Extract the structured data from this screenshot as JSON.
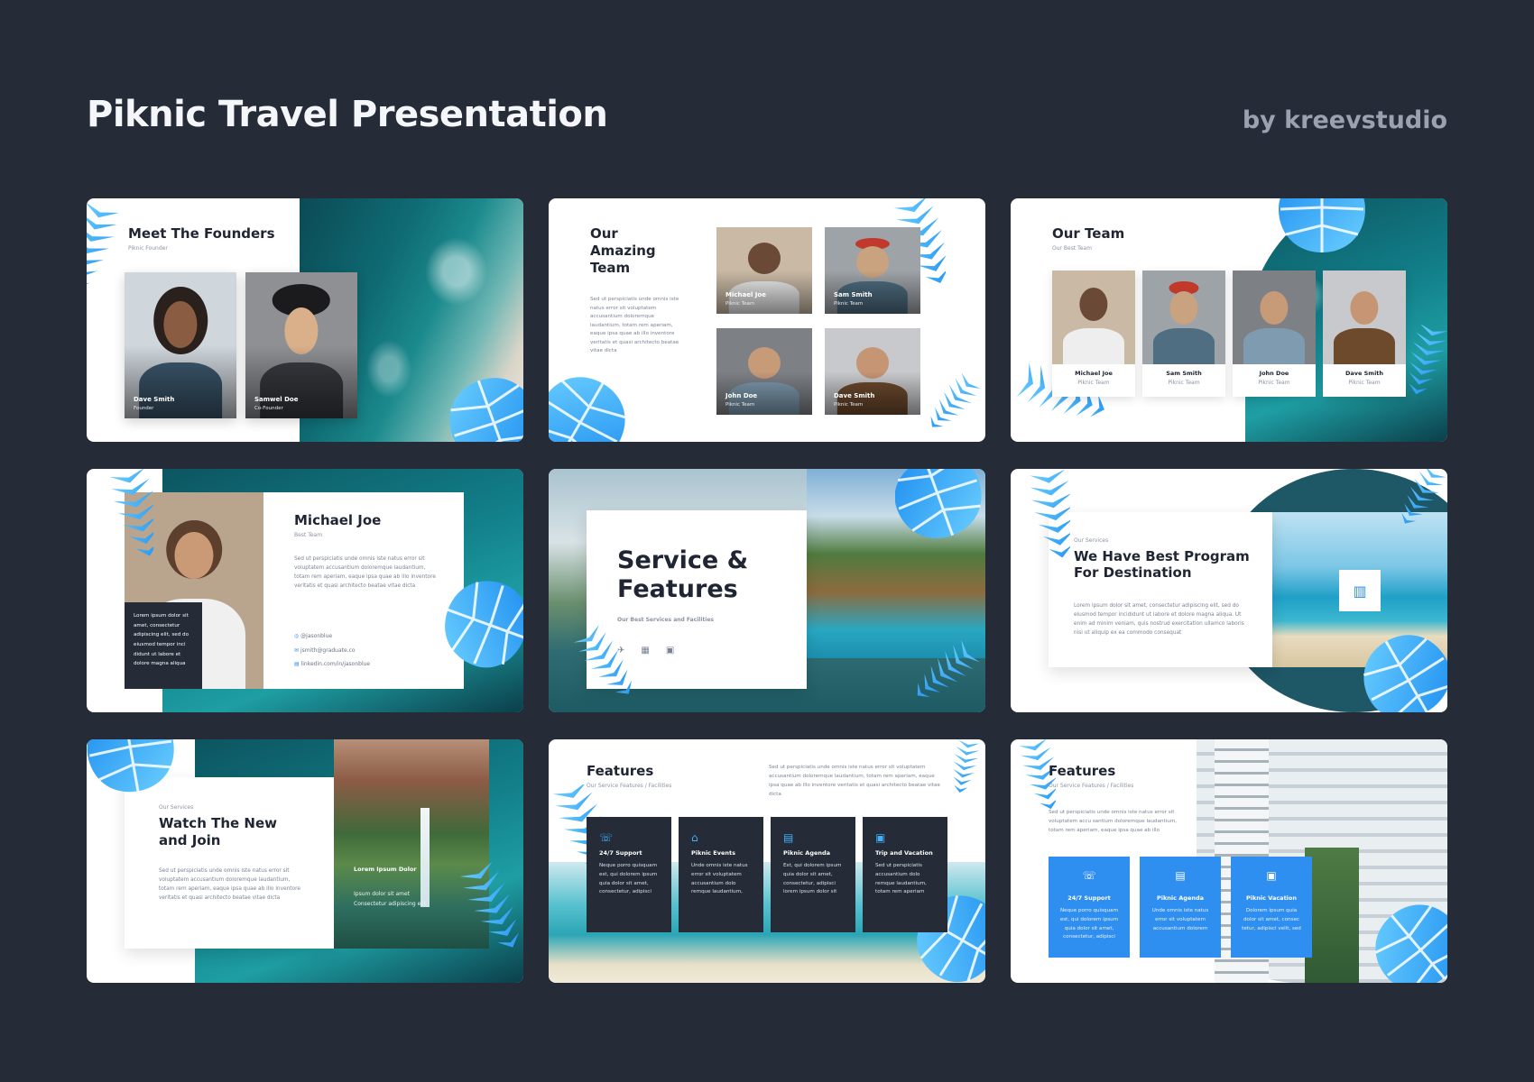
{
  "header": {
    "title": "Piknic Travel Presentation",
    "byline": "by kreevstudio"
  },
  "lorem": {
    "team": "Sed ut perspiciatis unde omnis iste natus error sit voluptatem accusantium doloremque laudantium, totam rem aperiam, eaque ipsa quae ab illo inventore veritatis et quasi architecto beatae vitae dicta",
    "michael": "Sed ut perspiciatis unde omnis iste natus error sit voluptatem accusantium doloremque laudantium, totam rem aperiam, eaque ipsa quae ab illo inventore veritatis et quasi architecto beatae vitae dicta",
    "michael_box": "Lorem ipsum dolor sit amet, consectetur adipiscing elit, sed do eiusmod tempor inci didunt ut labore et dolore magna aliqua",
    "program": "Lorem ipsum dolor sit amet, consectetur adipiscing elit, sed do eiusmod tempor incididunt ut labore et dolore magna aliqua. Ut enim ad minim veniam, quis nostrud exercitation ullamco laboris nisi ut aliquip ex ea commodo consequat",
    "watch": "Sed ut perspiciatis unde omnis iste natus error sit voluptatem accusantium doloremque laudantium, totam rem aperiam, eaque ipsa quae ab illo inventore veritatis et quasi architecto beatae vitae dicta",
    "features8": "Sed ut perspiciatis unde omnis iste natus error sit voluptatem accusantium doloremque laudantium, totam rem aperiam, eaque ipsa quae ab illo inventore veritatis et quasi architecto beatae vitae dicta",
    "features9": "Sed ut perspiciatis unde omnis iste natus error sit voluptatem accu santium doloremque laudantium, totam rem aperiam, eaque ipsa quae ab illo"
  },
  "slides": {
    "s1": {
      "title": "Meet The Founders",
      "subtitle": "Piknic Founder",
      "people": [
        {
          "name": "Dave Smith",
          "role": "Founder"
        },
        {
          "name": "Samwel Doe",
          "role": "Co-Founder"
        }
      ]
    },
    "s2": {
      "title_l1": "Our",
      "title_l2": "Amazing",
      "title_l3": "Team",
      "people": [
        {
          "name": "Michael Joe",
          "role": "Piknic Team"
        },
        {
          "name": "Sam Smith",
          "role": "Piknic Team"
        },
        {
          "name": "John Doe",
          "role": "Piknic Team"
        },
        {
          "name": "Dave Smith",
          "role": "Piknic Team"
        }
      ]
    },
    "s3": {
      "title": "Our Team",
      "subtitle": "Our Best Team",
      "people": [
        {
          "name": "Michael Joe",
          "role": "Piknic Team"
        },
        {
          "name": "Sam Smith",
          "role": "Piknic Team"
        },
        {
          "name": "John Doe",
          "role": "Piknic Team"
        },
        {
          "name": "Dave Smith",
          "role": "Piknic Team"
        }
      ]
    },
    "s4": {
      "name": "Michael Joe",
      "role": "Best Team",
      "social": [
        "@jasonblue",
        "jsmith@graduate.co",
        "linkedin.com/in/jasonblue"
      ]
    },
    "s5": {
      "title_l1": "Service &",
      "title_l2": "Features",
      "subtitle": "Our Best Services and Facilities"
    },
    "s6": {
      "kicker": "Our Services",
      "title_l1": "We Have Best Program",
      "title_l2": "For Destination"
    },
    "s7": {
      "kicker": "Our Services",
      "title_l1": "Watch The New",
      "title_l2": "and Join",
      "photo_title": "Lorem Ipsum Dolor",
      "photo_text_l1": "Ipsum dolor sit amet",
      "photo_text_l2": "Consectetur adipiscing elit"
    },
    "s8": {
      "title": "Features",
      "subtitle": "Our Service Features / Facilities",
      "cards": [
        {
          "title": "24/7 Support",
          "text": "Neque porro quisquam est, qui dolorem ipsum quia dolor sit amet, consectetur, adipisci"
        },
        {
          "title": "Piknic Events",
          "text": "Unde omnis iste natus error sit voluptatem accusantium dolo remque laudantium,"
        },
        {
          "title": "Piknic Agenda",
          "text": "Est, qui dolorem ipsum quia dolor sit amet, consectetur, adipisci lorem ipsum dolor sit"
        },
        {
          "title": "Trip and Vacation",
          "text": "Sed ut perspiciatis accusantium dolo remque laudantium, totam rem aperiam"
        }
      ]
    },
    "s9": {
      "title": "Features",
      "subtitle": "Our Service Features / Facilities",
      "cards": [
        {
          "title": "24/7 Support",
          "text": "Neque porro quisquam est, qui dolorem ipsum quia dolor sit amet, consectetur, adipisci"
        },
        {
          "title": "Piknic Agenda",
          "text": "Unde omnis iste natus error sit voluptatem accusantium dolorem"
        },
        {
          "title": "Piknic Vacation",
          "text": "Dolorem ipsum quia dolor sit amet, consec tetur, adipisci velit, sed"
        }
      ]
    }
  },
  "colors": {
    "background": "#252b37",
    "accent_blue": "#2f8ff0",
    "leaf_blue": "#3fb0ff",
    "dark_card": "#252b37"
  },
  "icons": [
    "phone-icon",
    "store-icon",
    "calendar-icon",
    "luggage-icon",
    "map-icon",
    "plane-icon",
    "building-icon",
    "email-icon",
    "linkedin-icon",
    "instagram-icon"
  ]
}
